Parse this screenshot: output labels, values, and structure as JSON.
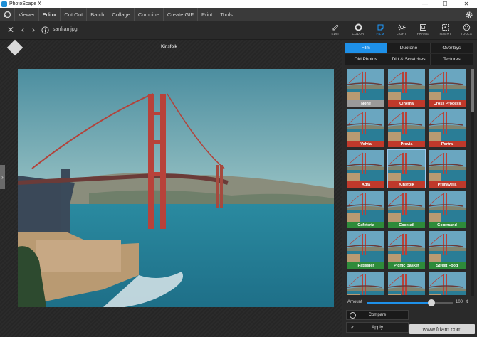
{
  "titlebar": {
    "title": "PhotoScape X",
    "minimize": "—",
    "maximize": "☐",
    "close": "✕"
  },
  "menu": [
    "Viewer",
    "Editor",
    "Cut Out",
    "Batch",
    "Collage",
    "Combine",
    "Create GIF",
    "Print",
    "Tools"
  ],
  "menu_active": "Editor",
  "toolbar": {
    "filename": "sanfran.jpg",
    "tools": [
      {
        "label": "EDIT",
        "icon": "edit-icon"
      },
      {
        "label": "COLOR",
        "icon": "color-icon"
      },
      {
        "label": "FILM",
        "icon": "film-icon"
      },
      {
        "label": "LIGHT",
        "icon": "light-icon"
      },
      {
        "label": "FRAME",
        "icon": "frame-icon"
      },
      {
        "label": "INSERT",
        "icon": "insert-icon"
      },
      {
        "label": "TOOLS",
        "icon": "tools-icon"
      }
    ],
    "active_tool": "FILM"
  },
  "canvas": {
    "preset_title": "Kinsfolk"
  },
  "panel": {
    "tabs_row1": [
      "Film",
      "Duotone",
      "Overlays"
    ],
    "tabs_row2": [
      "Old Photos",
      "Dirt & Scratches",
      "Textures"
    ],
    "active_tab": "Film",
    "presets": [
      {
        "name": "None",
        "color": "#9a9a9a"
      },
      {
        "name": "Cinema",
        "color": "#c0392b"
      },
      {
        "name": "Cross Process",
        "color": "#c0392b"
      },
      {
        "name": "Velvia",
        "color": "#c0392b"
      },
      {
        "name": "Provia",
        "color": "#c0392b"
      },
      {
        "name": "Portra",
        "color": "#c0392b"
      },
      {
        "name": "Agfa",
        "color": "#c0392b"
      },
      {
        "name": "Kinsfolk",
        "color": "#c0392b"
      },
      {
        "name": "Primavera",
        "color": "#c0392b"
      },
      {
        "name": "Cafeteria",
        "color": "#2e8b3a"
      },
      {
        "name": "Cocktail",
        "color": "#2e8b3a"
      },
      {
        "name": "Gourmand",
        "color": "#2e8b3a"
      },
      {
        "name": "Patissier",
        "color": "#2e8b3a"
      },
      {
        "name": "Picnic Basket",
        "color": "#2e8b3a"
      },
      {
        "name": "Street Food",
        "color": "#2e8b3a"
      },
      {
        "name": "",
        "color": "#2e8b3a"
      },
      {
        "name": "",
        "color": "#2e8b3a"
      },
      {
        "name": "",
        "color": "#2e8b3a"
      }
    ],
    "selected_preset": "Kinsfolk",
    "amount_label": "Amount",
    "amount_value": "100",
    "amount_fraction": 0.75,
    "compare_label": "Compare",
    "apply_label": "Apply"
  },
  "watermark": "www.frfam.com"
}
